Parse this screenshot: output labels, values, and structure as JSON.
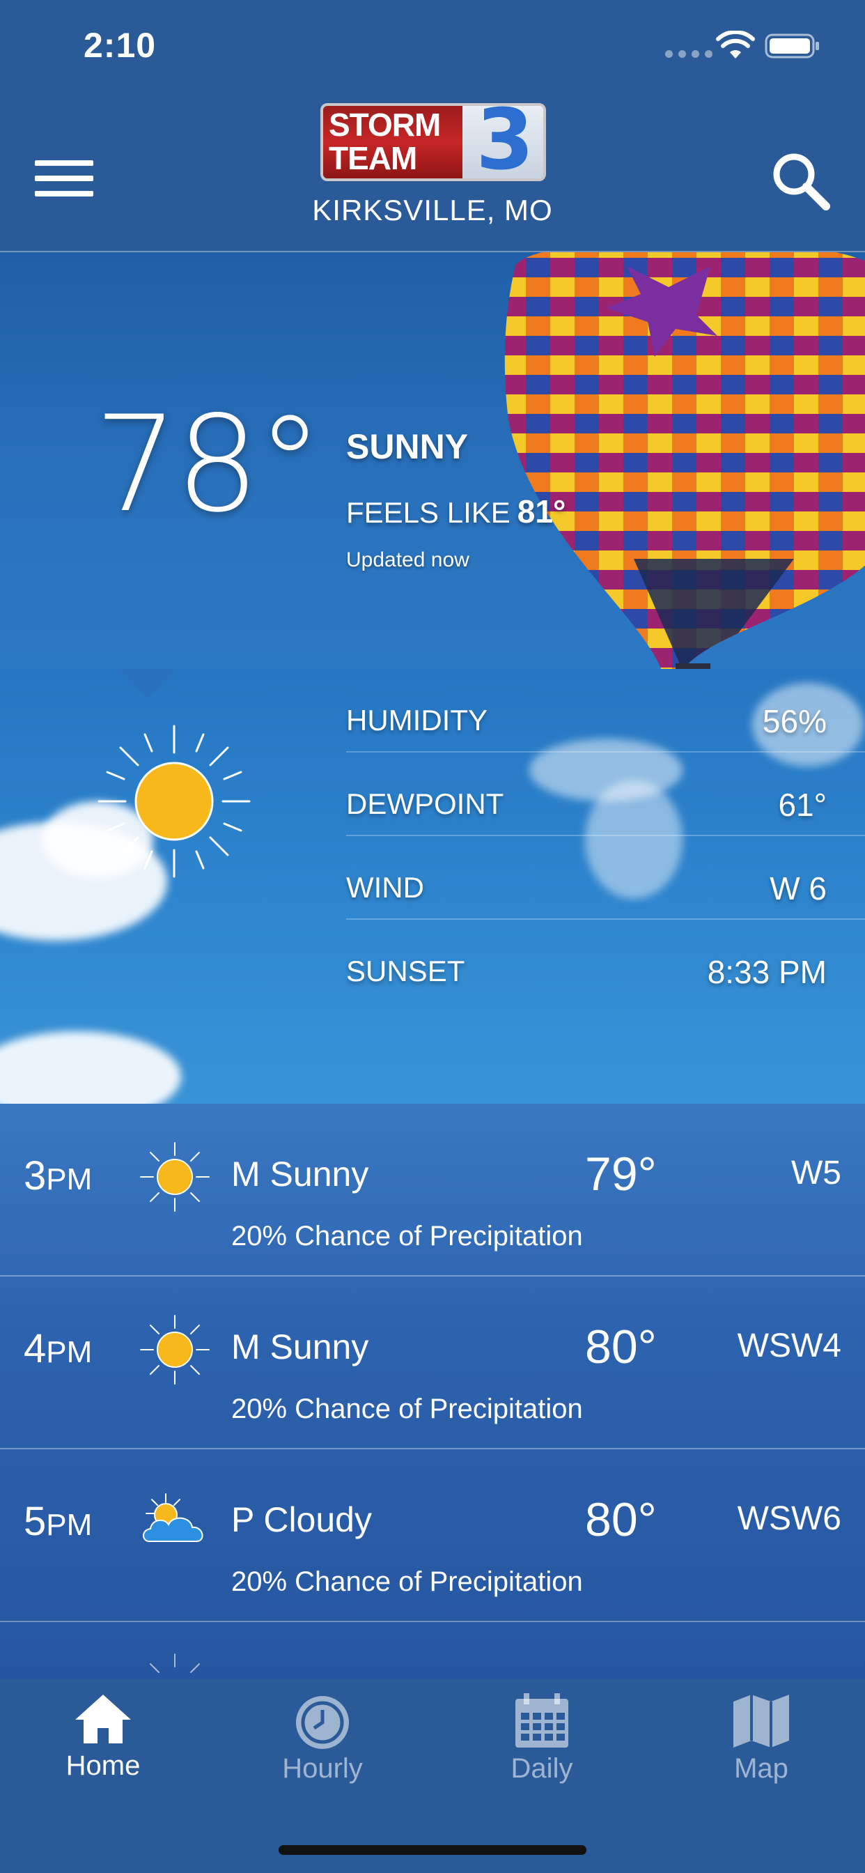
{
  "status_bar": {
    "time": "2:10"
  },
  "header": {
    "logo_line1": "STORM",
    "logo_line2": "TEAM",
    "logo_number": "3",
    "location": "KIRKSVILLE, MO"
  },
  "current": {
    "temperature": "78°",
    "condition": "SUNNY",
    "feels_like_label": "FEELS LIKE",
    "feels_like_value": "81°",
    "updated": "Updated now",
    "icon": "sun-icon"
  },
  "details": [
    {
      "label": "HUMIDITY",
      "value": "56%"
    },
    {
      "label": "DEWPOINT",
      "value": "61°"
    },
    {
      "label": "WIND",
      "value": "W 6"
    },
    {
      "label": "SUNSET",
      "value": "8:33 PM"
    }
  ],
  "hourly": [
    {
      "hour": "3",
      "period": "PM",
      "icon": "sun-icon",
      "condition": "M Sunny",
      "temp": "79°",
      "wind": "W5",
      "precip": "20% Chance of Precipitation"
    },
    {
      "hour": "4",
      "period": "PM",
      "icon": "sun-icon",
      "condition": "M Sunny",
      "temp": "80°",
      "wind": "WSW4",
      "precip": "20% Chance of Precipitation"
    },
    {
      "hour": "5",
      "period": "PM",
      "icon": "partly-cloudy-icon",
      "condition": "P Cloudy",
      "temp": "80°",
      "wind": "WSW6",
      "precip": "20% Chance of Precipitation"
    }
  ],
  "tabs": [
    {
      "label": "Home",
      "icon": "home-icon",
      "active": true
    },
    {
      "label": "Hourly",
      "icon": "clock-icon",
      "active": false
    },
    {
      "label": "Daily",
      "icon": "calendar-icon",
      "active": false
    },
    {
      "label": "Map",
      "icon": "map-icon",
      "active": false
    }
  ],
  "colors": {
    "header_bg": "#2a5a98",
    "sun_yellow": "#f7b81b",
    "logo_red": "#c72626",
    "logo_blue": "#2d6fd0"
  }
}
